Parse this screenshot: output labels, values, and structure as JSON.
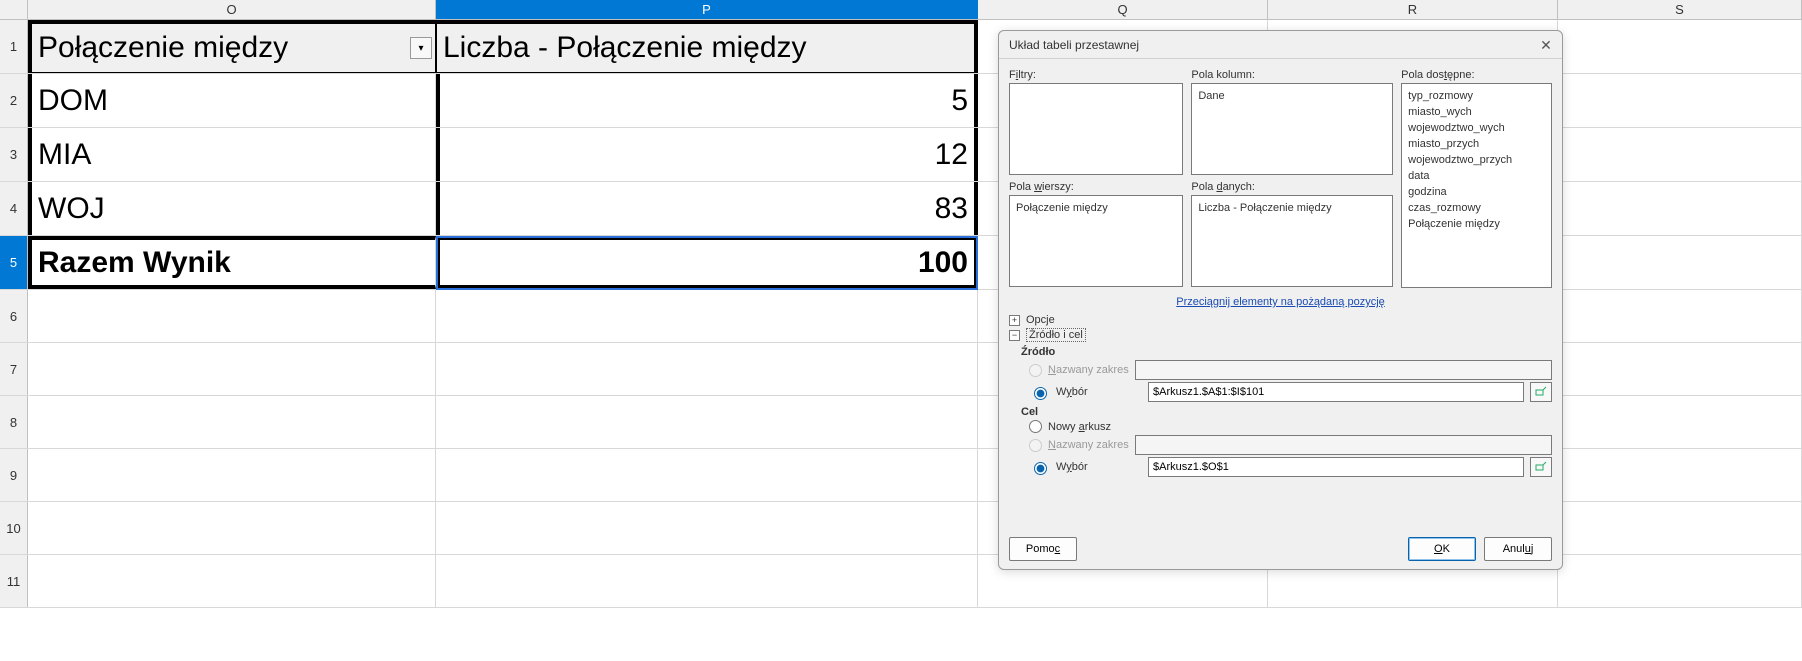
{
  "columns": {
    "O": "O",
    "P": "P",
    "Q": "Q",
    "R": "R",
    "S": "S"
  },
  "rows": [
    "1",
    "2",
    "3",
    "4",
    "5",
    "6",
    "7",
    "8",
    "9",
    "10",
    "11"
  ],
  "pivot": {
    "header_row": "Połączenie między",
    "header_val": "Liczba - Połączenie między",
    "rows": [
      {
        "label": "DOM",
        "value": "5"
      },
      {
        "label": "MIA",
        "value": "12"
      },
      {
        "label": "WOJ",
        "value": "83"
      }
    ],
    "total_label": "Razem Wynik",
    "total_value": "100"
  },
  "dialog": {
    "title": "Układ tabeli przestawnej",
    "labels": {
      "filters_pre": "F",
      "filters_ul": "i",
      "filters_post": "ltry:",
      "colfields": "Pola kolumn:",
      "rowfields_pre": "Pola ",
      "rowfields_ul": "w",
      "rowfields_post": "ierszy:",
      "datafields_pre": "Pola ",
      "datafields_ul": "d",
      "datafields_post": "anych:",
      "avail_pre": "Pola dos",
      "avail_ul": "t",
      "avail_post": "ępne:"
    },
    "col_fields": [
      "Dane"
    ],
    "row_fields": [
      "Połączenie między"
    ],
    "data_fields": [
      "Liczba - Połączenie między"
    ],
    "avail_fields": [
      "typ_rozmowy",
      "miasto_wych",
      "wojewodztwo_wych",
      "miasto_przych",
      "wojewodztwo_przych",
      "data",
      "godzina",
      "czas_rozmowy",
      "Połączenie między"
    ],
    "drag_hint_pre": "Przeci",
    "drag_hint_ul": "ą",
    "drag_hint_post": "gnij elementy na pożądaną pozycję",
    "tree": {
      "opcje": "Opcje",
      "src": "Źródło i cel"
    },
    "source_heading": "Źródło",
    "dest_heading": "Cel",
    "named_range_pre": "",
    "named_range_ul": "N",
    "named_range_post": "azwany zakres",
    "selection_pre": "W",
    "selection_ul": "y",
    "selection_post": "bór",
    "new_sheet_pre": "Nowy ",
    "new_sheet_ul": "a",
    "new_sheet_post": "rkusz",
    "src_value": "$Arkusz1.$A$1:$I$101",
    "dest_value": "$Arkusz1.$O$1",
    "buttons": {
      "help_pre": "Pomo",
      "help_ul": "c",
      "ok_ul": "O",
      "ok_post": "K",
      "cancel_pre": "Anul",
      "cancel_ul": "u",
      "cancel_post": "j"
    }
  }
}
